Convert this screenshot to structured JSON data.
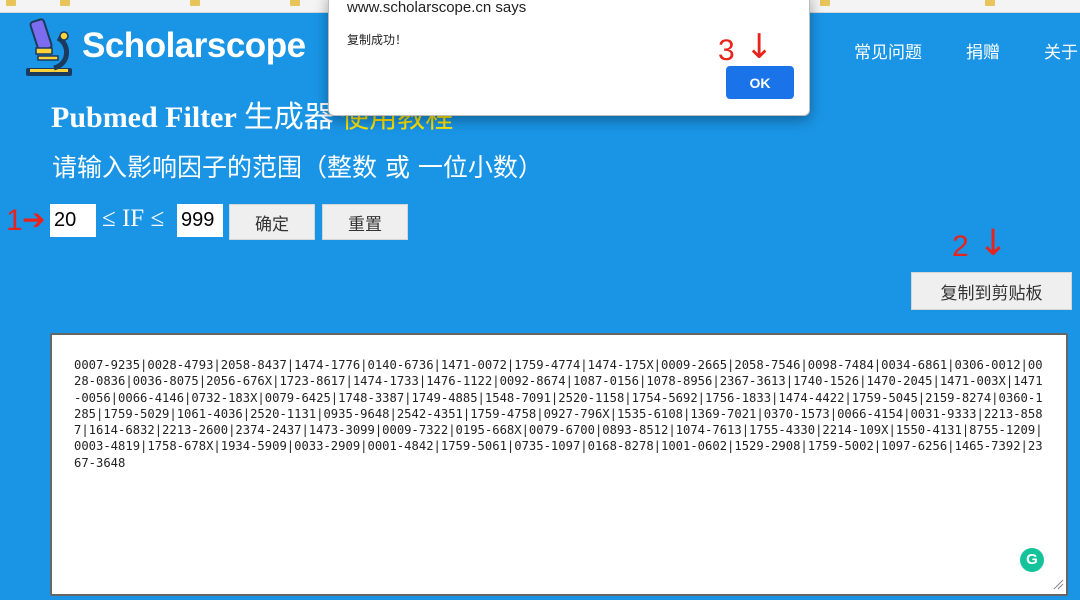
{
  "dialog": {
    "origin": "www.scholarscope.cn says",
    "message": "复制成功！",
    "ok_label": "OK"
  },
  "brand": {
    "name": "Scholarscope"
  },
  "nav": {
    "faq": "常见问题",
    "donate": "捐赠",
    "about": "关于"
  },
  "page": {
    "title_main": "Pubmed Filter",
    "title_sub": "生成器",
    "tutorial_link": "使用教程",
    "subtitle": "请输入影响因子的范围（整数 或 一位小数）"
  },
  "filter": {
    "min_value": "20",
    "max_value": "999",
    "if_label": "≤ IF ≤",
    "confirm_label": "确定",
    "reset_label": "重置",
    "copy_label": "复制到剪贴板"
  },
  "annotations": {
    "step1": "1",
    "step2": "2",
    "step3": "3"
  },
  "result": {
    "text": "0007-9235|0028-4793|2058-8437|1474-1776|0140-6736|1471-0072|1759-4774|1474-175X|0009-2665|2058-7546|0098-7484|0034-6861|0306-0012|0028-0836|0036-8075|2056-676X|1723-8617|1474-1733|1476-1122|0092-8674|1087-0156|1078-8956|2367-3613|1740-1526|1470-2045|1471-003X|1471-0056|0066-4146|0732-183X|0079-6425|1748-3387|1749-4885|1548-7091|2520-1158|1754-5692|1756-1833|1474-4422|1759-5045|2159-8274|0360-1285|1759-5029|1061-4036|2520-1131|0935-9648|2542-4351|1759-4758|0927-796X|1535-6108|1369-7021|0370-1573|0066-4154|0031-9333|2213-8587|1614-6832|2213-2600|2374-2437|1473-3099|0009-7322|0195-668X|0079-6700|0893-8512|1074-7613|1755-4330|2214-109X|1550-4131|8755-1209|0003-4819|1758-678X|1934-5909|0033-2909|0001-4842|1759-5061|0735-1097|0168-8278|1001-0602|1529-2908|1759-5002|1097-6256|1465-7392|2367-3648"
  },
  "colors": {
    "page_bg": "#1a95e6",
    "annotation_red": "#e8231d",
    "tutorial_yellow": "#ffe400",
    "dialog_button": "#1a73e8"
  }
}
